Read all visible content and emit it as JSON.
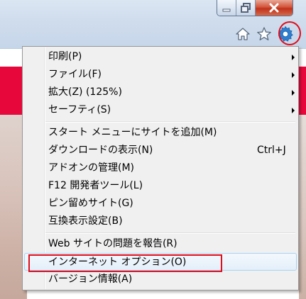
{
  "window": {
    "caption": {
      "minimize": "minimize",
      "maximize": "maximize",
      "close": "close"
    },
    "toolbar": {
      "icons": [
        "home-icon",
        "star-icon",
        "gear-icon"
      ]
    }
  },
  "colors": {
    "menu_bg": "#f0f0f0",
    "highlight_red": "#e10d1a",
    "page_red": "#e8073b",
    "gear_blue": "#2f7fd0"
  },
  "menu": {
    "items": [
      {
        "label": "印刷(P)",
        "submenu": true
      },
      {
        "label": "ファイル(F)",
        "submenu": true
      },
      {
        "label": "拡大(Z) (125%)",
        "submenu": true
      },
      {
        "label": "セーフティ(S)",
        "submenu": true
      },
      {
        "label": "スタート メニューにサイトを追加(M)"
      },
      {
        "label": "ダウンロードの表示(N)",
        "shortcut": "Ctrl+J"
      },
      {
        "label": "アドオンの管理(M)"
      },
      {
        "label": "F12 開発者ツール(L)"
      },
      {
        "label": "ピン留めサイト(G)"
      },
      {
        "label": "互換表示設定(B)"
      },
      {
        "label": "Web サイトの問題を報告(R)"
      },
      {
        "label": "インターネット オプション(O)",
        "highlighted": true
      },
      {
        "label": "バージョン情報(A)"
      }
    ]
  }
}
